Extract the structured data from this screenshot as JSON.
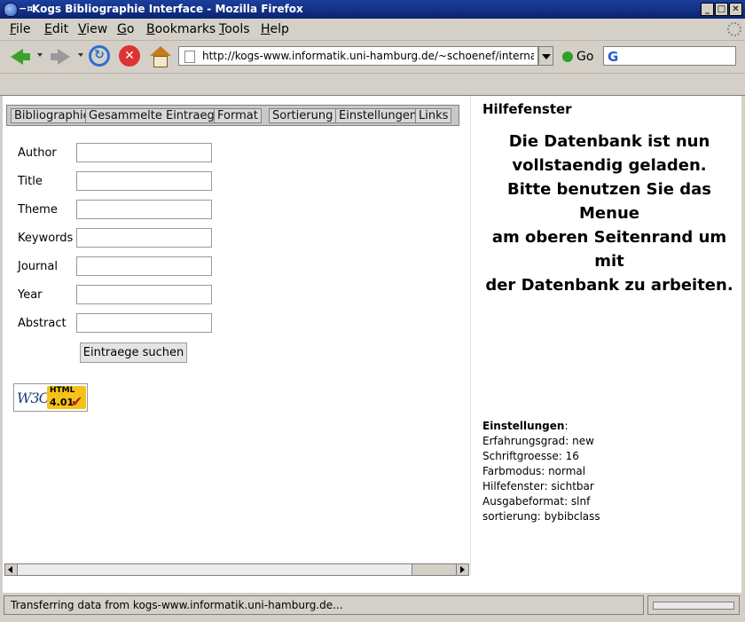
{
  "window": {
    "title": "Kogs Bibliographie Interface - Mozilla Firefox",
    "pin_glyph": "−¤",
    "controls": {
      "minimize": "_",
      "maximize": "□",
      "close": "✕"
    }
  },
  "menu": {
    "file": {
      "key": "F",
      "rest": "ile"
    },
    "edit": {
      "key": "E",
      "rest": "dit"
    },
    "view": {
      "key": "V",
      "rest": "iew"
    },
    "go": {
      "key": "G",
      "rest": "o"
    },
    "bookmarks": {
      "key": "B",
      "rest": "ookmarks"
    },
    "tools": {
      "key": "T",
      "rest": "ools"
    },
    "help": {
      "key": "H",
      "rest": "elp"
    }
  },
  "toolbar": {
    "url": "http://kogs-www.informatik.uni-hamburg.de/~schoenef/interna/bro",
    "go_label": "Go",
    "reload_glyph": "↻",
    "stop_glyph": "✕",
    "search_glyph": "G"
  },
  "tabs": [
    {
      "label": "Bibliographie"
    },
    {
      "label": "Gesammelte Eintraege"
    },
    {
      "label": "Format"
    },
    {
      "label": "Sortierung"
    },
    {
      "label": "Einstellungen"
    },
    {
      "label": "Links"
    }
  ],
  "form": {
    "fields": [
      {
        "label": "Author",
        "value": ""
      },
      {
        "label": "Title",
        "value": ""
      },
      {
        "label": "Theme",
        "value": ""
      },
      {
        "label": "Keywords",
        "value": ""
      },
      {
        "label": "Journal",
        "value": ""
      },
      {
        "label": "Year",
        "value": ""
      },
      {
        "label": "Abstract",
        "value": ""
      }
    ],
    "submit_label": "Eintraege suchen"
  },
  "badge": {
    "w3c": "W3C",
    "html": "HTML",
    "version": "4.01",
    "check": "✔"
  },
  "help": {
    "title": "Hilfefenster",
    "message_lines": [
      "Die Datenbank ist nun",
      "vollstaendig geladen.",
      "Bitte benutzen Sie das Menue",
      "am oberen Seitenrand um mit",
      "der Datenbank zu arbeiten."
    ]
  },
  "settings": {
    "heading": "Einstellungen",
    "heading_suffix": ":",
    "lines": [
      "Erfahrungsgrad: new",
      "Schriftgroesse: 16",
      "Farbmodus: normal",
      "Hilfefenster: sichtbar",
      "Ausgabeformat: slnf",
      "sortierung: bybibclass"
    ]
  },
  "status": {
    "text": "Transferring data from kogs-www.informatik.uni-hamburg.de..."
  }
}
